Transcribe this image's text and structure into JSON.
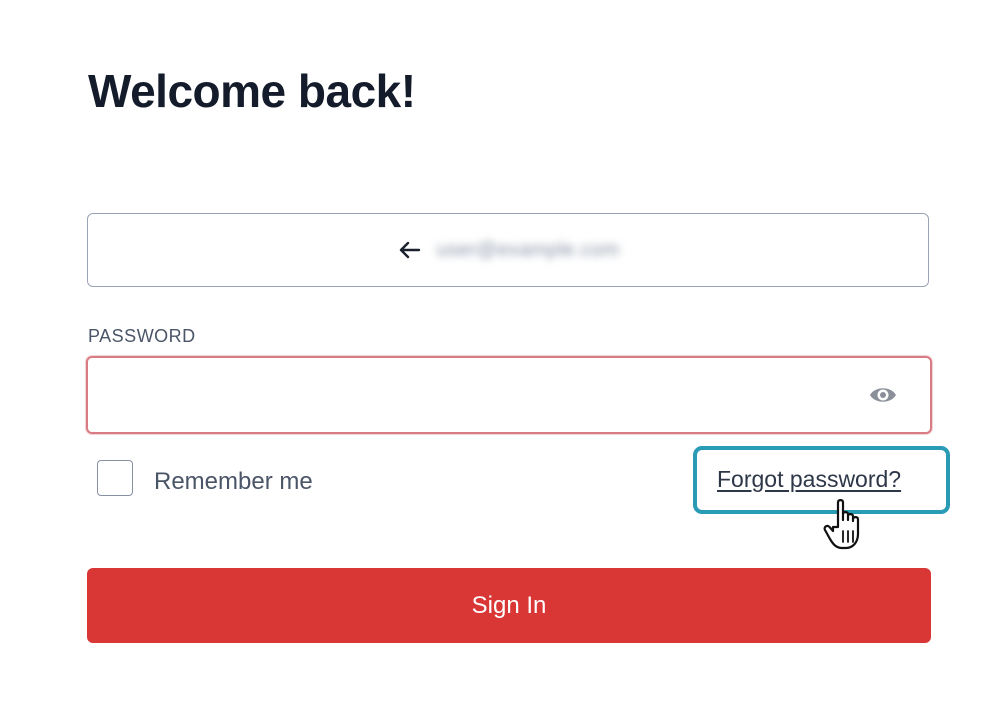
{
  "header": {
    "title": "Welcome back!"
  },
  "email_field": {
    "icon": "arrow-left-icon",
    "value": "user@example.com"
  },
  "password_field": {
    "label": "PASSWORD",
    "value": "",
    "icon": "eye-icon",
    "border_color": "#d87b84"
  },
  "remember_me": {
    "label": "Remember me",
    "checked": false
  },
  "forgot_password": {
    "label": "Forgot password?",
    "highlight_color": "#2a9bb5"
  },
  "sign_in": {
    "label": "Sign In",
    "color": "#d93636"
  },
  "cursor": {
    "icon": "pointer-hand-icon"
  }
}
